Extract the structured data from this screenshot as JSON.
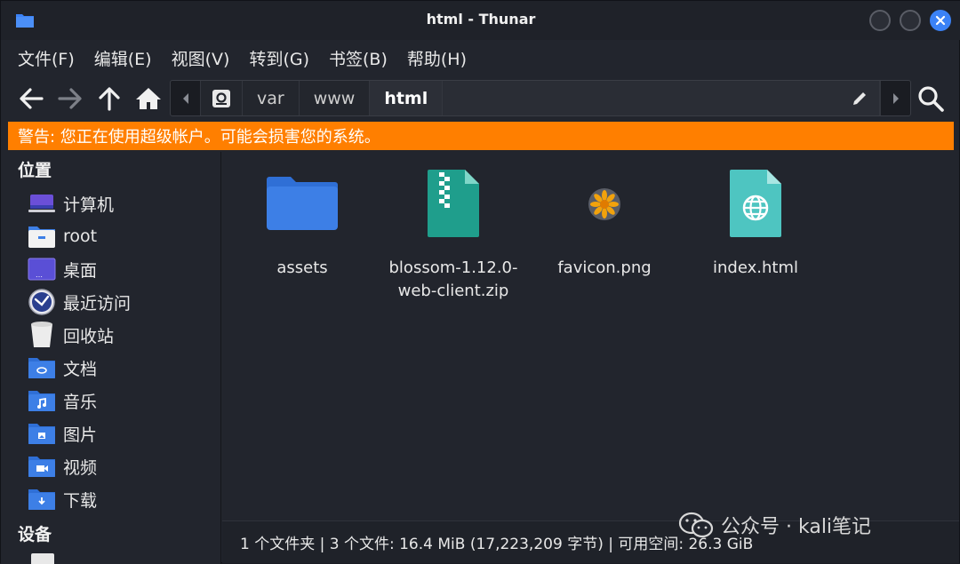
{
  "window": {
    "title": "html - Thunar"
  },
  "menu": [
    "文件(F)",
    "编辑(E)",
    "视图(V)",
    "转到(G)",
    "书签(B)",
    "帮助(H)"
  ],
  "path": {
    "crumbs": [
      "var",
      "www",
      "html"
    ]
  },
  "warning": "警告: 您正在使用超级帐户。可能会损害您的系统。",
  "sidebar": {
    "places_heading": "位置",
    "items": [
      {
        "label": "计算机",
        "icon": "computer-icon"
      },
      {
        "label": "root",
        "icon": "home-folder-icon"
      },
      {
        "label": "桌面",
        "icon": "desktop-icon"
      },
      {
        "label": "最近访问",
        "icon": "recent-icon"
      },
      {
        "label": "回收站",
        "icon": "trash-icon"
      },
      {
        "label": "文档",
        "icon": "documents-folder-icon"
      },
      {
        "label": "音乐",
        "icon": "music-folder-icon"
      },
      {
        "label": "图片",
        "icon": "pictures-folder-icon"
      },
      {
        "label": "视频",
        "icon": "videos-folder-icon"
      },
      {
        "label": "下载",
        "icon": "downloads-folder-icon"
      }
    ],
    "devices_heading": "设备"
  },
  "files": [
    {
      "name": "assets",
      "icon": "folder-icon"
    },
    {
      "name": "blossom-1.12.0-web-client.zip",
      "icon": "zip-icon"
    },
    {
      "name": "favicon.png",
      "icon": "image-icon"
    },
    {
      "name": "index.html",
      "icon": "html-icon"
    }
  ],
  "status": "1 个文件夹 | 3 个文件: 16.4 MiB (17,223,209 字节) | 可用空间: 26.3 GiB",
  "watermark": "公众号 · kali笔记",
  "colors": {
    "accent": "#3b82f6",
    "warning": "#ff7f00",
    "folder": "#3d7fe6",
    "zip": "#1f9e8c",
    "html": "#4ec5c1"
  }
}
